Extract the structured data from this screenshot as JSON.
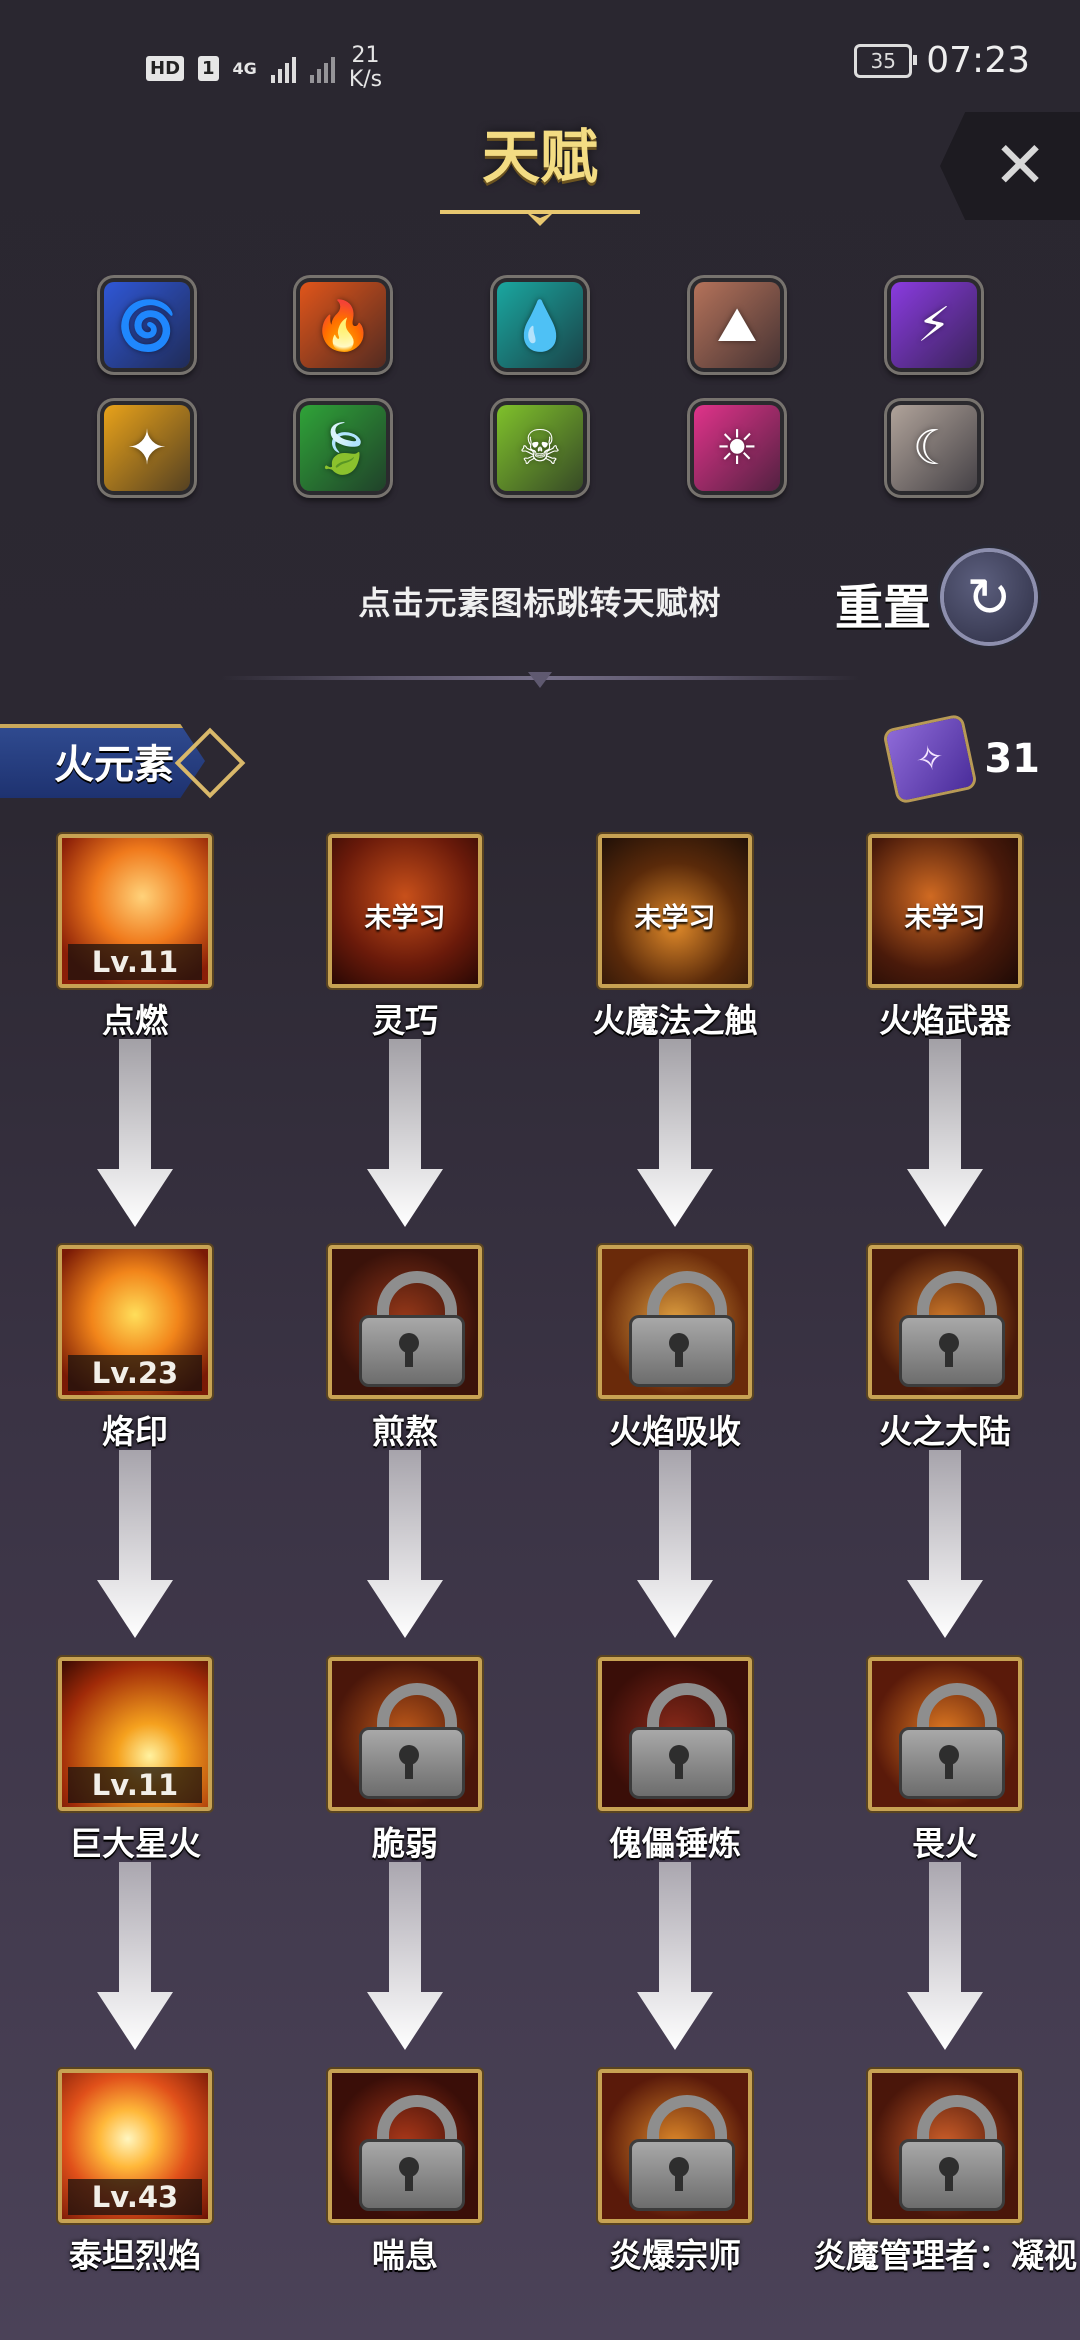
{
  "status_bar": {
    "badge_hd": "HD",
    "badge_sim": "1",
    "net_type": "4G",
    "speed_value": "21",
    "speed_unit": "K/s",
    "battery": "35",
    "time": "07:23"
  },
  "header": {
    "title": "天赋",
    "close_symbol": "✕"
  },
  "elements": [
    {
      "icon": "tornado-icon",
      "glyph": "🌀",
      "color": "#2f57d6"
    },
    {
      "icon": "fire-icon",
      "glyph": "🔥",
      "color": "#e0551a"
    },
    {
      "icon": "water-drop-icon",
      "glyph": "💧",
      "color": "#1aa7a0"
    },
    {
      "icon": "rock-icon",
      "glyph": "⛰",
      "color": "#b4725a"
    },
    {
      "icon": "lightning-icon",
      "glyph": "⚡",
      "color": "#8a3be0"
    },
    {
      "icon": "light-icon",
      "glyph": "✦",
      "color": "#e8a21a"
    },
    {
      "icon": "leaf-icon",
      "glyph": "🍃",
      "color": "#2fa338"
    },
    {
      "icon": "skull-icon",
      "glyph": "☠",
      "color": "#7fc12b"
    },
    {
      "icon": "sun-icon",
      "glyph": "☀",
      "color": "#e0338a"
    },
    {
      "icon": "moon-icon",
      "glyph": "☾",
      "color": "#b0a39a"
    }
  ],
  "hint": "点击元素图标跳转天赋树",
  "reset": {
    "label": "重置",
    "icon": "reset-icon",
    "glyph": "↻"
  },
  "element_banner": {
    "label": "火元素"
  },
  "points": {
    "icon": "scroll-icon",
    "value": "31"
  },
  "skill_tree": {
    "rows": [
      [
        {
          "name": "点燃",
          "state": "level",
          "level": "Lv.11",
          "bg": "radial-gradient(circle at 55% 40%,#ffd27a,#f07a1c 40%,#8a1e08 80%)"
        },
        {
          "name": "灵巧",
          "state": "unlearned",
          "label": "未学习",
          "bg": "radial-gradient(circle at 50% 40%,#c8501a,#6a1a0a 60%,#2a0804)"
        },
        {
          "name": "火魔法之触",
          "state": "unlearned",
          "label": "未学习",
          "bg": "radial-gradient(circle at 50% 60%,#e08a2a,#5a2a0a 55%,#201008)"
        },
        {
          "name": "火焰武器",
          "state": "unlearned",
          "label": "未学习",
          "bg": "radial-gradient(circle at 40% 40%,#d06a22,#4a1a0a 60%,#1e0a06)"
        }
      ],
      [
        {
          "name": "烙印",
          "state": "level",
          "level": "Lv.23",
          "bg": "radial-gradient(circle at 50% 45%,#ffde5a,#f2851a 40%,#7a1a06 85%)"
        },
        {
          "name": "煎熬",
          "state": "locked",
          "bg": "radial-gradient(circle at 50% 50%,#9a3a1a,#3a120a 70%)"
        },
        {
          "name": "火焰吸收",
          "state": "locked",
          "bg": "radial-gradient(circle at 50% 50%,#e0a040,#6a2a0a 70%)"
        },
        {
          "name": "火之大陆",
          "state": "locked",
          "bg": "radial-gradient(circle at 50% 50%,#d07a2a,#4a1a0a 70%)"
        }
      ],
      [
        {
          "name": "巨大星火",
          "state": "level",
          "level": "Lv.11",
          "bg": "radial-gradient(circle at 60% 65%,#fff2a0,#f5a11e 25%,#a02a08 70%,#3a0a02)"
        },
        {
          "name": "脆弱",
          "state": "locked",
          "bg": "radial-gradient(circle at 50% 50%,#c05a1a,#4a160a 70%)"
        },
        {
          "name": "傀儡锤炼",
          "state": "locked",
          "bg": "radial-gradient(circle at 50% 50%,#8a2a1a,#3a0e08 70%)"
        },
        {
          "name": "畏火",
          "state": "locked",
          "bg": "radial-gradient(circle at 50% 50%,#e07a22,#5a1a0a 70%)"
        }
      ],
      [
        {
          "name": "泰坦烈焰",
          "state": "level",
          "level": "Lv.43",
          "bg": "radial-gradient(circle at 45% 45%,#fff6c0,#ffb83a 25%,#e0501a 55%,#6a1204)"
        },
        {
          "name": "喘息",
          "state": "locked",
          "bg": "radial-gradient(circle at 50% 50%,#b03a1a,#3a0e08 70%)"
        },
        {
          "name": "炎爆宗师",
          "state": "locked",
          "bg": "radial-gradient(circle at 50% 50%,#e08a2a,#5a1a0a 70%)"
        },
        {
          "name": "炎魔管理者：凝视",
          "state": "locked",
          "bg": "radial-gradient(circle at 50% 50%,#d0602a,#4a160a 70%)"
        }
      ]
    ]
  }
}
